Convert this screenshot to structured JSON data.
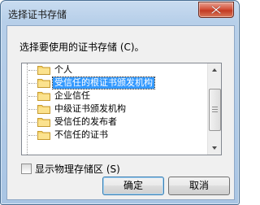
{
  "window": {
    "title": "选择证书存储",
    "close_icon": "close-icon"
  },
  "prompt": "选择要使用的证书存储 (C)。",
  "stores": [
    {
      "label": "个人",
      "selected": false
    },
    {
      "label": "受信任的根证书颁发机构",
      "selected": true
    },
    {
      "label": "企业信任",
      "selected": false
    },
    {
      "label": "中级证书颁发机构",
      "selected": false
    },
    {
      "label": "受信任的发布者",
      "selected": false
    },
    {
      "label": "不信任的证书",
      "selected": false
    }
  ],
  "show_physical": {
    "label": "显示物理存储区 (S)",
    "checked": false
  },
  "buttons": {
    "ok": "确定",
    "cancel": "取消"
  },
  "colors": {
    "selection": "#3399ff",
    "titlebar": "#b7cfe9",
    "close_button": "#c23a22"
  }
}
